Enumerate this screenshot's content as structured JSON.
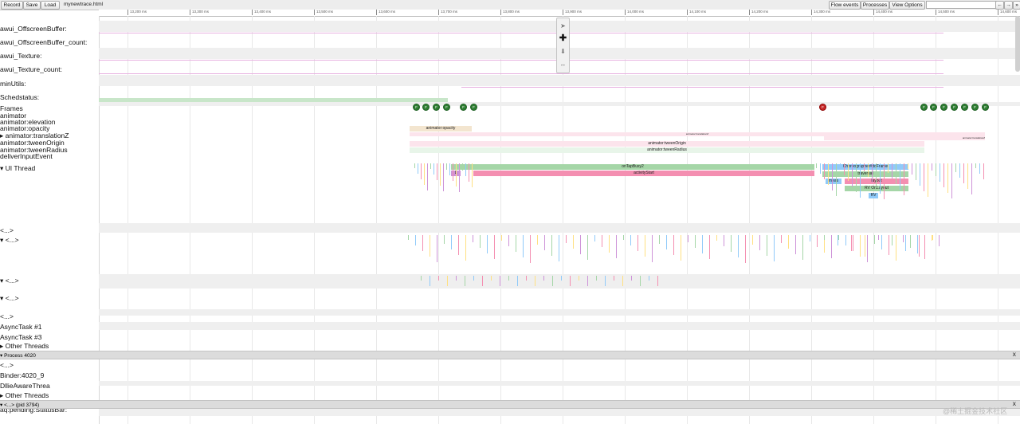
{
  "toolbar": {
    "record_label": "Record",
    "save_label": "Save",
    "load_label": "Load",
    "filename": "mynewtrace.html",
    "flow_events_label": "Flow events",
    "processes_label": "Processes",
    "view_options_label": "View Options",
    "search_placeholder": "",
    "prev_label": "←",
    "next_label": "→",
    "more_label": "»"
  },
  "ruler": {
    "ticks": [
      "13,200 ms",
      "13,300 ms",
      "13,400 ms",
      "13,500 ms",
      "13,600 ms",
      "13,700 ms",
      "13,800 ms",
      "13,900 ms",
      "14,000 ms",
      "14,100 ms",
      "14,200 ms",
      "14,300 ms",
      "14,400 ms",
      "14,500 ms",
      "14,600 ms"
    ]
  },
  "tracks": {
    "labels": [
      "awui_OffscreenBuffer:",
      "awui_OffscreenBuffer_count:",
      "awui_Texture:",
      "awui_Texture_count:",
      "minUtils:",
      "Schedstatus:",
      "Frames",
      "animator",
      "animator:elevation",
      "animator:opacity",
      "▸ animator:translationZ",
      "animator:tweenOrigin",
      "animator:tweenRadius",
      "deliverInputEvent",
      "▾ UI Thread",
      "<...>",
      "▾ <...>",
      "▾ <...>",
      "▾ <...>",
      "<...>",
      "AsyncTask #1",
      "AsyncTask #3",
      "▸ Other Threads",
      "<...>",
      "Binder:4020_9",
      "DllieAwareThrea",
      "▸ Other Threads",
      "aq:pending:StatusBar:"
    ]
  },
  "frames": {
    "good_label": "F",
    "bad_label": "F"
  },
  "slices": {
    "anim_opacity": "animator:opacity",
    "anim_translationZ": "animator:translationZ",
    "anim_tweenOrigin": "animator:tweenOrigin",
    "anim_tweenRadius": "animator:tweenRadius",
    "on_tap_busy": "onTapBusy2",
    "activity_start": "activityStart",
    "choreographer": "Choreographer#doFrame",
    "traversal": "traversal",
    "layout": "layout",
    "rv_onlayout": "RV OnLayout",
    "rv": "RV",
    "meas": "meas",
    "l_short": "L"
  },
  "process_bars": {
    "process_4020": "▾ Process 4020",
    "pid_3794": "▾ <...> (pid 3794)",
    "close_label": "X"
  },
  "watermark": "@稀土掘金技术社区",
  "colors": {
    "green_slice": "#a5d6a7",
    "blue_slice": "#90caf9",
    "pink_slice": "#f48fb1",
    "light_pink": "#fce4ec",
    "tan": "#f3e5cf",
    "counter_line": "#e7b1e0"
  }
}
